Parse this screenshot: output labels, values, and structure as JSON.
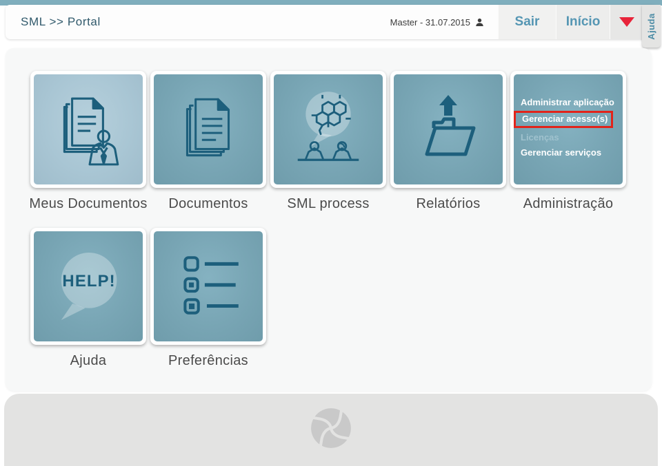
{
  "header": {
    "breadcrumb": "SML >> Portal",
    "user_label": "Master - 31.07.2015",
    "sair_label": "Sair",
    "inicio_label": "Início",
    "ajuda_tab_label": "Ajuda"
  },
  "tiles": {
    "meus_documentos": {
      "label": "Meus Documentos"
    },
    "documentos": {
      "label": "Documentos"
    },
    "sml_process": {
      "label": "SML process"
    },
    "relatorios": {
      "label": "Relatórios"
    },
    "administracao": {
      "label": "Administração",
      "links": [
        {
          "label": "Administrar aplicação",
          "state": "normal"
        },
        {
          "label": "Gerenciar acesso(s)",
          "state": "highlighted"
        },
        {
          "label": "Licenças",
          "state": "disabled"
        },
        {
          "label": "Gerenciar serviços",
          "state": "normal"
        }
      ]
    },
    "ajuda": {
      "label": "Ajuda",
      "bubble_text": "HELP!"
    },
    "preferencias": {
      "label": "Preferências"
    }
  },
  "icons": {
    "user": "person-silhouette",
    "dropdown": "red-triangle-down",
    "meus_documentos": "documents-with-person",
    "documentos": "stacked-documents",
    "sml_process": "molecule-chat-bubble-people",
    "relatorios": "open-folder-upload-arrow",
    "ajuda": "help-speech-bubble",
    "preferencias": "checklist",
    "footer_logo": "aperture-pinwheel"
  },
  "colors": {
    "topbar_teal": "#7FAEBD",
    "tile_teal": "#78A5B4",
    "tile_teal_light": "#A9C6D4",
    "icon_teal": "#1D5F7C",
    "button_text_teal": "#5596B3",
    "breadcrumb_teal": "#30596B",
    "highlight_red": "#E2231A",
    "caret_red": "#E8243A",
    "footer_gray": "#E3E3E2",
    "logo_gray": "#C9C9C9"
  }
}
